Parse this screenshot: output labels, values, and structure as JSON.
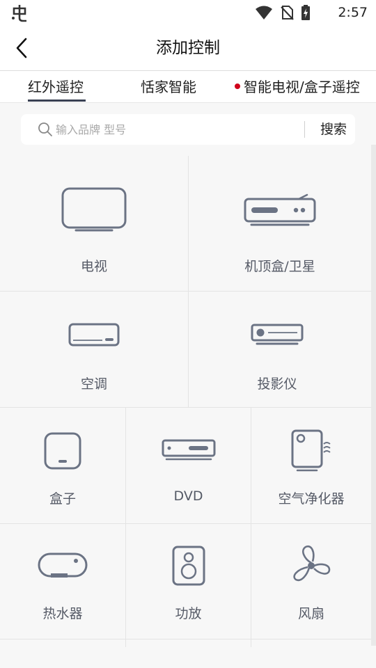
{
  "status": {
    "time": "2:57"
  },
  "header": {
    "title": "添加控制"
  },
  "tabs": [
    {
      "label": "红外遥控"
    },
    {
      "label": "恬家智能"
    },
    {
      "label": "智能电视/盒子遥控"
    }
  ],
  "search": {
    "placeholder": "输入品牌 型号",
    "button_label": "搜索"
  },
  "devices": [
    {
      "label": "电视"
    },
    {
      "label": "机顶盒/卫星"
    },
    {
      "label": "空调"
    },
    {
      "label": "投影仪"
    },
    {
      "label": "盒子"
    },
    {
      "label": "DVD"
    },
    {
      "label": "空气净化器"
    },
    {
      "label": "热水器"
    },
    {
      "label": "功放"
    },
    {
      "label": "风扇"
    }
  ],
  "colors": {
    "icon_stroke": "#6b7384",
    "tab_indicator": "#3a4154",
    "badge_dot": "#d0021b"
  }
}
